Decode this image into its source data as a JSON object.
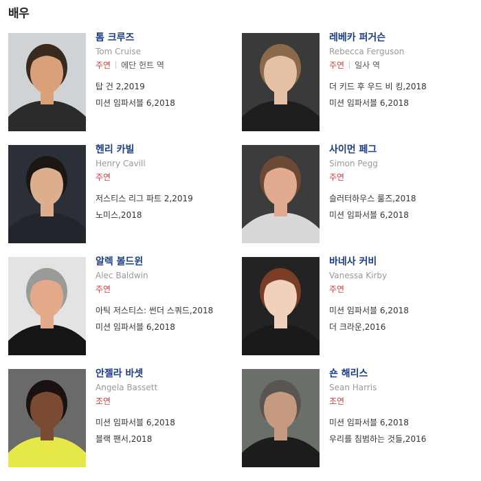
{
  "section": {
    "title": "배우"
  },
  "actors": [
    {
      "name": "톰 크루즈",
      "english": "Tom Cruise",
      "role": "주연",
      "character": "에단 헌트 역",
      "works": [
        "탑 건 2,2019",
        "미션 임파서블 6,2018"
      ],
      "colors": {
        "bg": "#cfd3d6",
        "skin": "#d9a07a",
        "hair": "#3a2a1e",
        "cloth": "#2b2b2b"
      }
    },
    {
      "name": "레베카 퍼거슨",
      "english": "Rebecca Ferguson",
      "role": "주연",
      "character": "일사 역",
      "works": [
        "더 키드 후 우드 비 킹,2018",
        "미션 임파서블 6,2018"
      ],
      "colors": {
        "bg": "#3a3a3a",
        "skin": "#e6c0a5",
        "hair": "#8a6a4a",
        "cloth": "#1e1e1e"
      }
    },
    {
      "name": "헨리 카빌",
      "english": "Henry Cavill",
      "role": "주연",
      "character": "",
      "works": [
        "저스티스 리그 파트 2,2019",
        "노미스,2018"
      ],
      "colors": {
        "bg": "#2a2f38",
        "skin": "#dcae8e",
        "hair": "#1c1613",
        "cloth": "#22252b"
      }
    },
    {
      "name": "사이먼 페그",
      "english": "Simon Pegg",
      "role": "주연",
      "character": "",
      "works": [
        "슬러터하우스 룰즈,2018",
        "미션 임파서블 6,2018"
      ],
      "colors": {
        "bg": "#3c3c3c",
        "skin": "#e2ab8f",
        "hair": "#6a4a35",
        "cloth": "#d8d8d8"
      }
    },
    {
      "name": "알렉 볼드윈",
      "english": "Alec Baldwin",
      "role": "주연",
      "character": "",
      "works": [
        "아틱 저스티스: 썬더 스쿼드,2018",
        "미션 임파서블 6,2018"
      ],
      "colors": {
        "bg": "#e3e3e3",
        "skin": "#e2a98a",
        "hair": "#9a9a96",
        "cloth": "#161616"
      }
    },
    {
      "name": "바네사 커비",
      "english": "Vanessa Kirby",
      "role": "주연",
      "character": "",
      "works": [
        "미션 임파서블 6,2018",
        "더 크라운,2016"
      ],
      "colors": {
        "bg": "#232323",
        "skin": "#efd1bc",
        "hair": "#7a3d26",
        "cloth": "#1a1a1a"
      }
    },
    {
      "name": "안젤라 바셋",
      "english": "Angela Bassett",
      "role": "조연",
      "character": "",
      "works": [
        "미션 임파서블 6,2018",
        "블랙 팬서,2018"
      ],
      "colors": {
        "bg": "#6a6a6a",
        "skin": "#7a4a33",
        "hair": "#1a1210",
        "cloth": "#e6e84a"
      }
    },
    {
      "name": "숀 해리스",
      "english": "Sean Harris",
      "role": "조연",
      "character": "",
      "works": [
        "미션 임파서블 6,2018",
        "우리를 침범하는 것들,2016"
      ],
      "colors": {
        "bg": "#6a6f6a",
        "skin": "#c69a7e",
        "hair": "#5a5550",
        "cloth": "#1c1c1c"
      }
    }
  ]
}
